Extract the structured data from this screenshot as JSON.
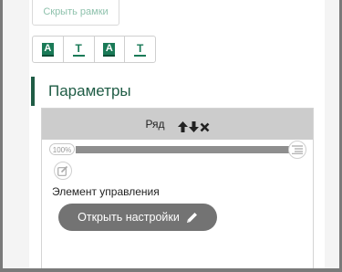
{
  "toolbar": {
    "hide_frames_label": "Скрыть рамки",
    "format_buttons": [
      {
        "glyph": "A",
        "style": "filled",
        "icon": "text-highlight-icon"
      },
      {
        "glyph": "T",
        "style": "outline",
        "icon": "text-underline-icon"
      },
      {
        "glyph": "A",
        "style": "filled",
        "icon": "text-highlight-icon"
      },
      {
        "glyph": "T",
        "style": "outline",
        "icon": "text-underline-icon"
      }
    ]
  },
  "section": {
    "title": "Параметры"
  },
  "row": {
    "label": "Ряд",
    "icons": [
      "arrow-up-icon",
      "arrow-down-icon",
      "close-icon"
    ],
    "slider": {
      "percent_label": "100%",
      "value_percent": 100
    },
    "control_label": "Элемент управления",
    "open_settings_label": "Открыть настройки"
  },
  "colors": {
    "accent": "#1a7a57",
    "section_title": "#1f5c45",
    "hide_frames_text": "#8fc2ad",
    "row_header": "#cccccc",
    "button_bg": "#737373",
    "outer_bg": "#7a7a7a"
  }
}
